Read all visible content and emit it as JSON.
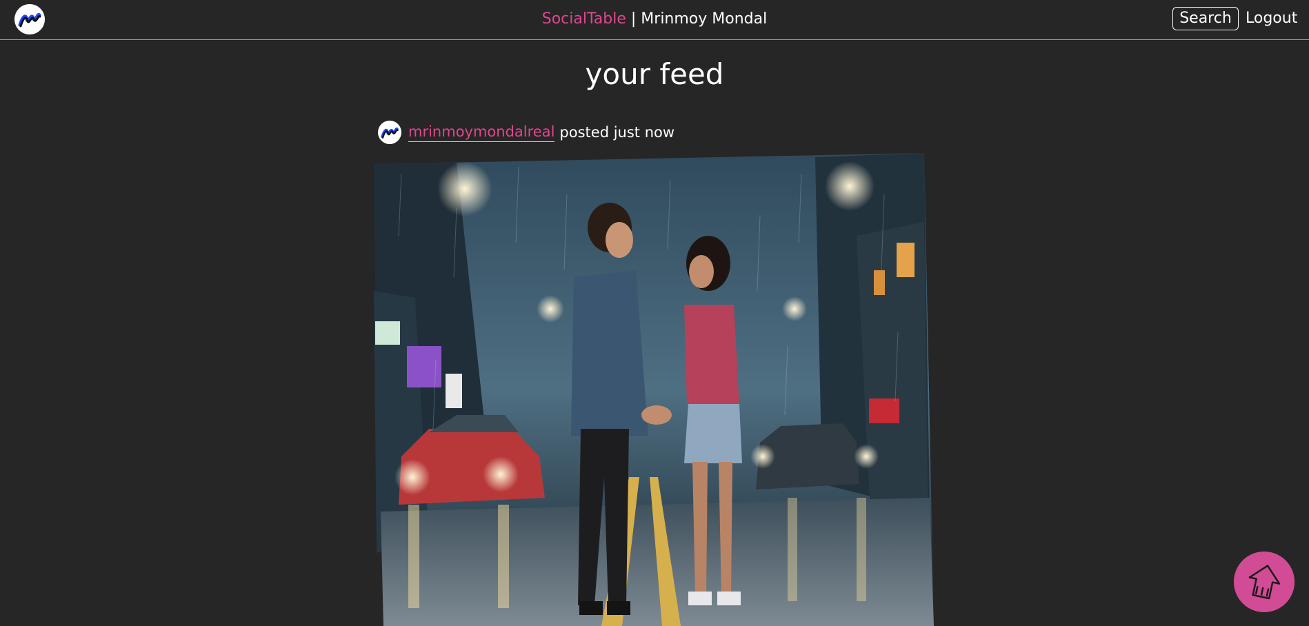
{
  "header": {
    "app_name": "SocialTable",
    "separator": "|",
    "user_name": "Mrinmoy Mondal",
    "search_label": "Search",
    "logout_label": "Logout",
    "logo_icon": "brand-m-logo-icon"
  },
  "feed": {
    "title": "your feed",
    "posts": [
      {
        "username": "mrinmoymondalreal",
        "meta": "posted just now",
        "image_description_icon": "couple-in-rain-street-image"
      }
    ]
  },
  "scroll_top_icon": "arrow-up-icon",
  "colors": {
    "background": "#262626",
    "accent": "#e0468f",
    "fab": "#d24b95",
    "text": "#ffffff"
  }
}
